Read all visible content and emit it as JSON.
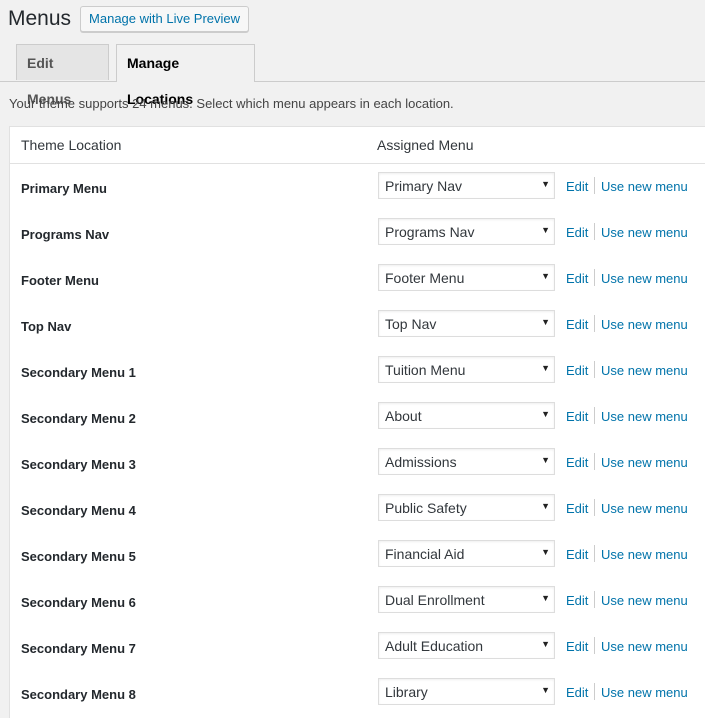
{
  "header": {
    "title": "Menus",
    "live_preview_label": "Manage with Live Preview"
  },
  "tabs": [
    {
      "label": "Edit Menus",
      "active": false
    },
    {
      "label": "Manage Locations",
      "active": true
    }
  ],
  "intro": "Your theme supports 24 menus. Select which menu appears in each location.",
  "table": {
    "col_location": "Theme Location",
    "col_assigned": "Assigned Menu",
    "edit_label": "Edit",
    "new_menu_label": "Use new menu",
    "rows": [
      {
        "location": "Primary Menu",
        "menu": "Primary Nav"
      },
      {
        "location": "Programs Nav",
        "menu": "Programs Nav"
      },
      {
        "location": "Footer Menu",
        "menu": "Footer Menu"
      },
      {
        "location": "Top Nav",
        "menu": "Top Nav"
      },
      {
        "location": "Secondary Menu 1",
        "menu": "Tuition Menu"
      },
      {
        "location": "Secondary Menu 2",
        "menu": "About"
      },
      {
        "location": "Secondary Menu 3",
        "menu": "Admissions"
      },
      {
        "location": "Secondary Menu 4",
        "menu": "Public Safety"
      },
      {
        "location": "Secondary Menu 5",
        "menu": "Financial Aid"
      },
      {
        "location": "Secondary Menu 6",
        "menu": "Dual Enrollment"
      },
      {
        "location": "Secondary Menu 7",
        "menu": "Adult Education"
      },
      {
        "location": "Secondary Menu 8",
        "menu": "Library"
      }
    ]
  },
  "icons": {
    "dropdown_arrow": "caret-down-icon"
  },
  "colors": {
    "link": "#0073aa",
    "background": "#f1f1f1",
    "panel": "#ffffff"
  }
}
